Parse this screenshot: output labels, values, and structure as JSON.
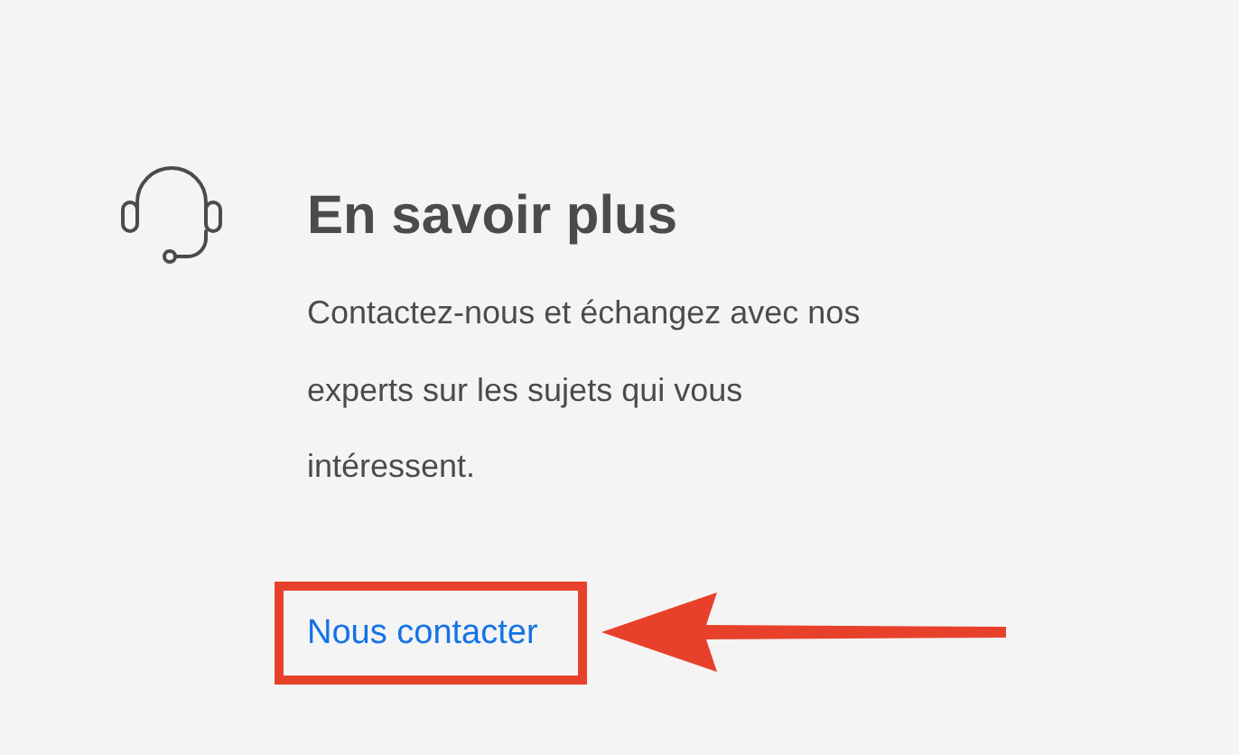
{
  "title": "En savoir plus",
  "description": "Contactez-nous et échangez avec nos experts sur les sujets qui vous intéressent.",
  "link": {
    "label": "Nous contacter"
  }
}
